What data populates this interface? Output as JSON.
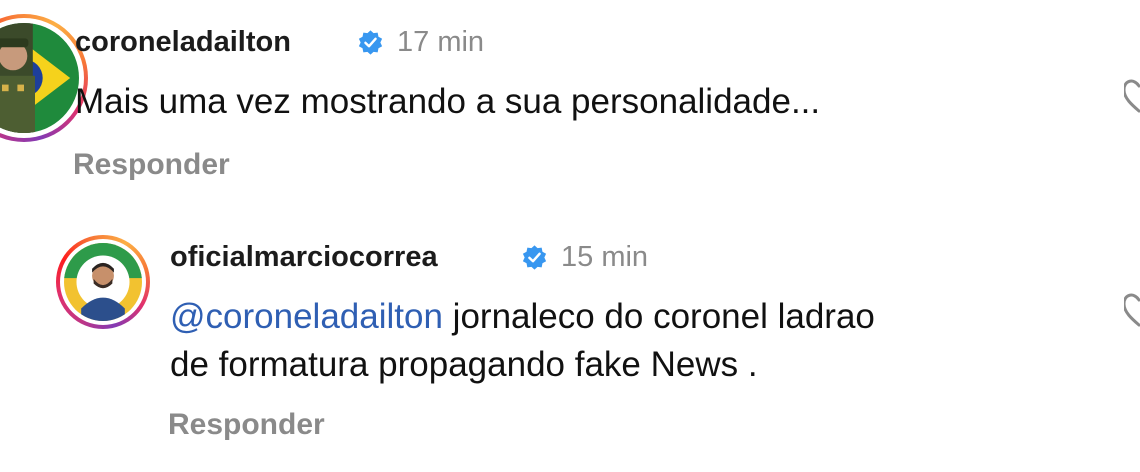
{
  "comments": [
    {
      "username": "coroneladailton",
      "verified": true,
      "time": "17 min",
      "text": "Mais uma vez mostrando a sua personalidade...",
      "reply_label": "Responder",
      "avatar_icon": "avatar-military-portrait"
    },
    {
      "username": "oficialmarciocorrea",
      "verified": true,
      "time": "15 min",
      "mention": "@coroneladailton",
      "text_line1": "jornaleco do coronel ladrao",
      "text_line2": "de formatura propagando fake News .",
      "reply_label": "Responder",
      "avatar_icon": "avatar-man-portrait"
    }
  ],
  "colors": {
    "verified_badge": "#3897f0",
    "mention": "#2f5fb3",
    "secondary_text": "#8a8a8a"
  },
  "icons": {
    "verified": "verified-badge-icon",
    "like": "heart-icon"
  }
}
